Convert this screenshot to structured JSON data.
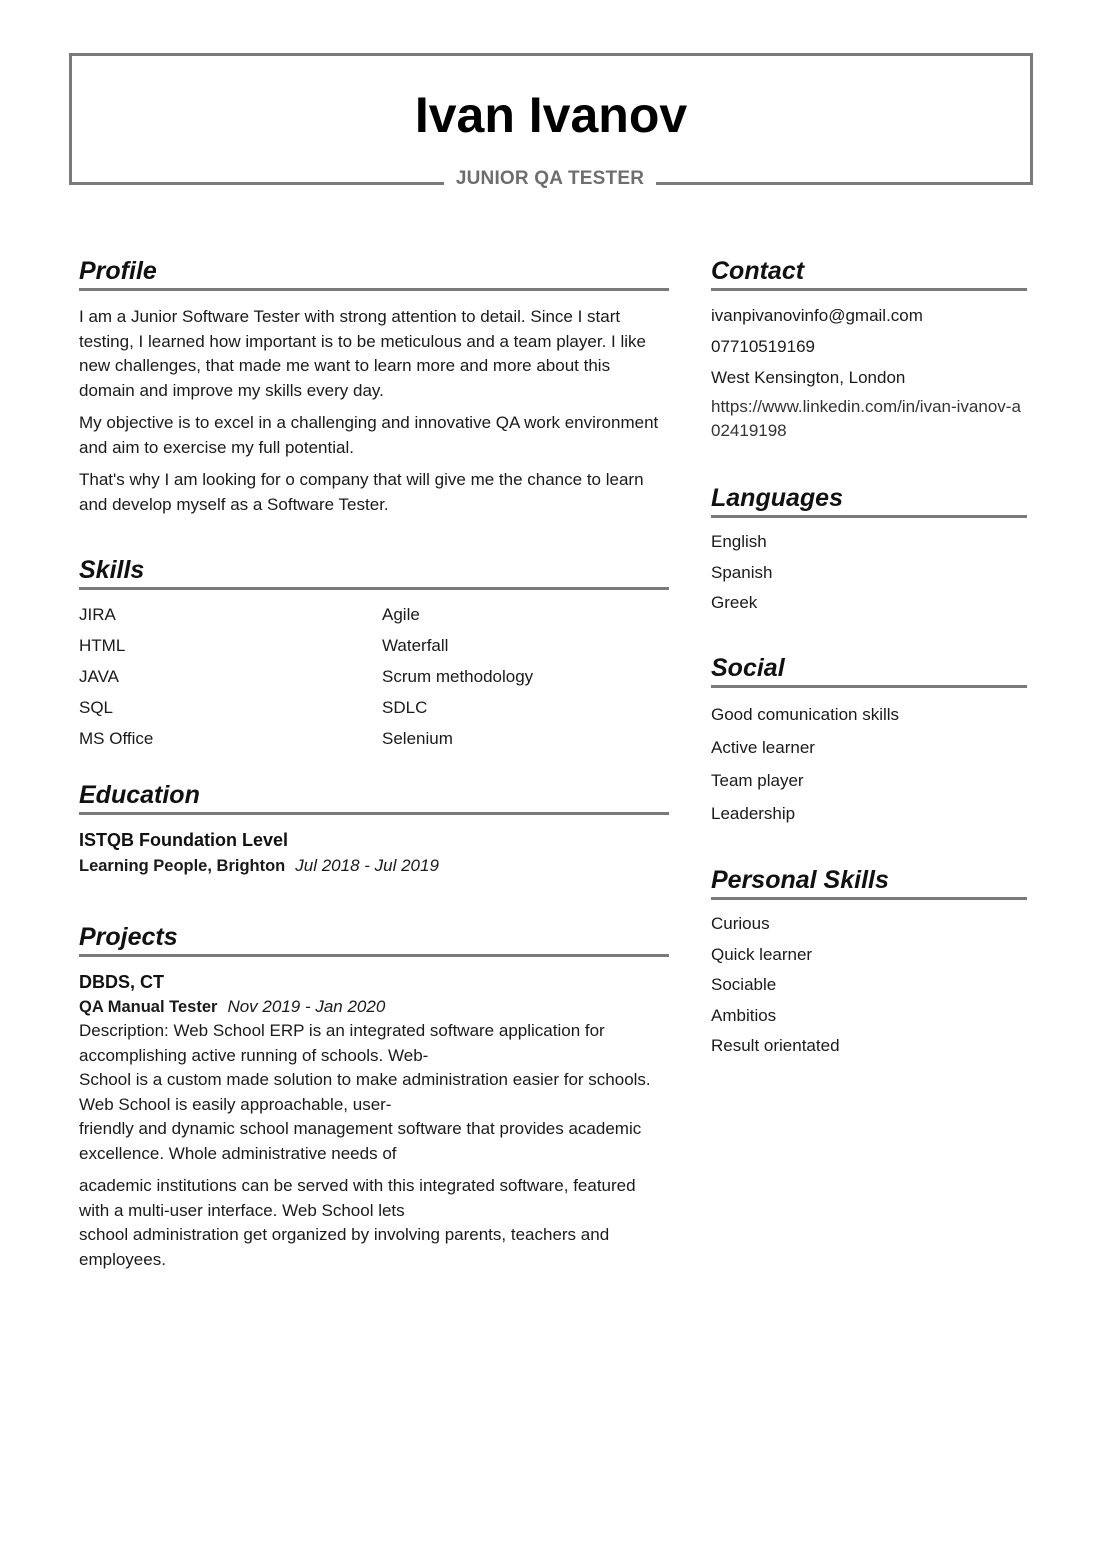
{
  "header": {
    "name": "Ivan Ivanov",
    "title": "JUNIOR QA TESTER"
  },
  "profile": {
    "heading": "Profile",
    "paragraphs": [
      "I am a Junior Software Tester with strong attention to detail. Since I start testing, I learned how important is to be meticulous and a team player. I like new challenges, that made me want to learn more and more about this domain and improve my skills every day.",
      "My objective is to excel in a challenging and innovative QA work environment and aim to exercise my full potential.",
      "That's why I am looking for o company that will give me the chance to learn and develop myself as a Software Tester."
    ]
  },
  "skills": {
    "heading": "Skills",
    "items": [
      "JIRA",
      "Agile",
      "HTML",
      "Waterfall",
      "JAVA",
      "Scrum methodology",
      "SQL",
      "SDLC",
      "MS Office",
      "Selenium"
    ]
  },
  "education": {
    "heading": "Education",
    "entries": [
      {
        "title": "ISTQB Foundation Level",
        "org": "Learning People, Brighton",
        "dates": "Jul 2018 - Jul 2019"
      }
    ]
  },
  "projects": {
    "heading": "Projects",
    "entries": [
      {
        "title": "DBDS, CT",
        "role": "QA Manual Tester",
        "dates": "Nov 2019 - Jan 2020",
        "description": [
          "Description: Web School ERP is an integrated software application for accomplishing active running of schools. Web-\nSchool is a custom made solution to make administration easier for schools. Web School is easily approachable, user-\nfriendly and dynamic school management software that provides academic excellence. Whole administrative needs of",
          "academic institutions can be served with this integrated software, featured with a multi-user interface. Web School lets\nschool administration get organized by involving parents, teachers and employees."
        ]
      }
    ]
  },
  "contact": {
    "heading": "Contact",
    "email": "ivanpivanovinfo@gmail.com",
    "phone": "07710519169",
    "location": "West Kensington, London",
    "linkedin": "https://www.linkedin.com/in/ivan-ivanov-a02419198"
  },
  "languages": {
    "heading": "Languages",
    "items": [
      "English",
      "Spanish",
      "Greek"
    ]
  },
  "social": {
    "heading": "Social",
    "items": [
      "Good comunication skills",
      "Active learner",
      "Team player",
      "Leadership"
    ]
  },
  "personal_skills": {
    "heading": "Personal Skills",
    "items": [
      "Curious",
      "Quick learner",
      "Sociable",
      "Ambitios",
      "Result orientated"
    ]
  }
}
